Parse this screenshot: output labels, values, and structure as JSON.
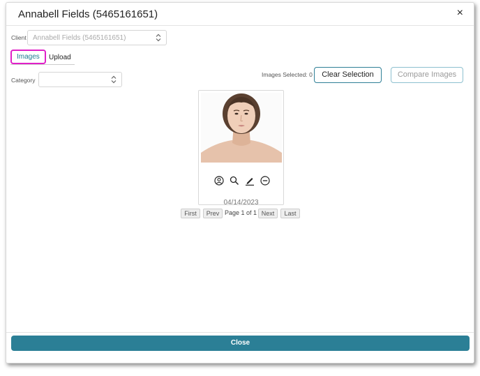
{
  "modal": {
    "title": "Annabell Fields (5465161651)",
    "close_glyph": "×"
  },
  "client": {
    "label": "Client",
    "value": "Annabell Fields (5465161651)"
  },
  "tabs": [
    {
      "label": "Images",
      "active": true
    },
    {
      "label": "Upload",
      "active": false
    }
  ],
  "category": {
    "label": "Category",
    "value": ""
  },
  "selection": {
    "label": "Images Selected:",
    "count": "0",
    "clear_label": "Clear Selection",
    "compare_label": "Compare Images"
  },
  "image_card": {
    "date": "04/14/2023",
    "icons": [
      "user-circle-icon",
      "search-icon",
      "pencil-icon",
      "minus-circle-icon"
    ]
  },
  "pagination": {
    "first": "First",
    "prev": "Prev",
    "page_text": "Page 1 of 1",
    "next": "Next",
    "last": "Last"
  },
  "footer": {
    "close_label": "Close"
  },
  "colors": {
    "accent": "#2b7f96",
    "tab_highlight": "#e020c8"
  }
}
